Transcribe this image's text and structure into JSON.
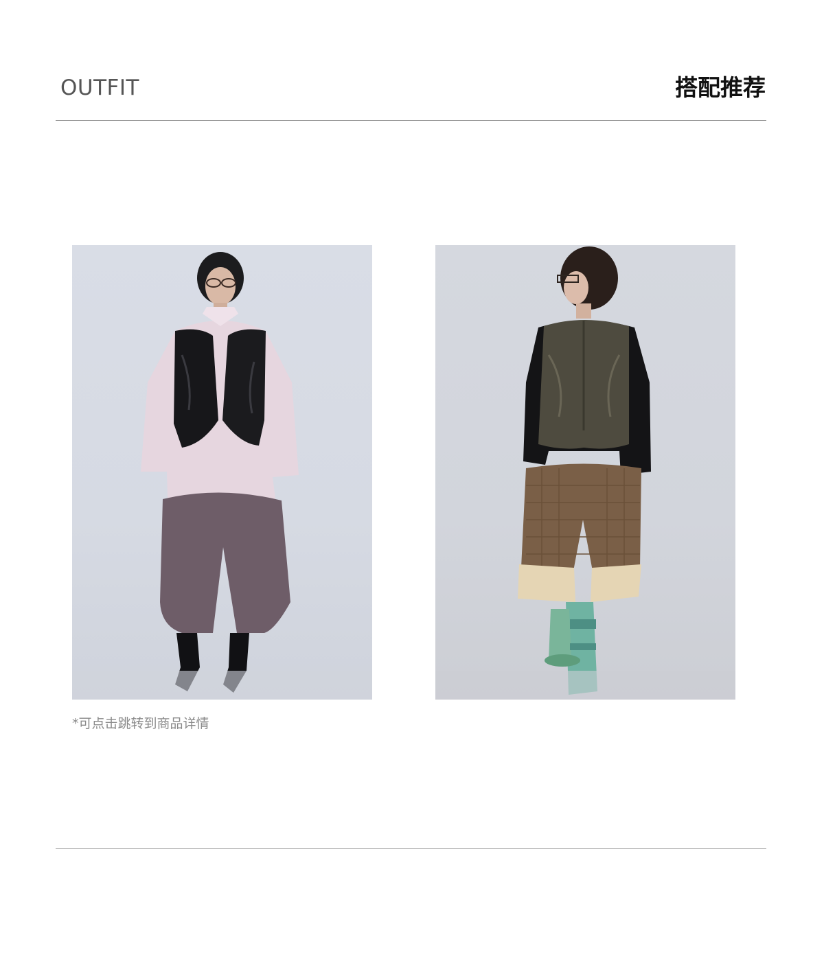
{
  "header": {
    "title_en": "OUTFIT",
    "title_cn": "搭配推荐"
  },
  "outfits": [
    {
      "icon": "model-photo-leather-vest-pink-shirt"
    },
    {
      "icon": "model-photo-brown-leather-vest-quilted-shorts"
    }
  ],
  "note": "*可点击跳转到商品详情",
  "colors": {
    "title_en": "#555555",
    "title_cn": "#111111",
    "rule": "#9a9a9a",
    "note": "#8a8a8a",
    "photo_bg": "#d8dce5"
  }
}
